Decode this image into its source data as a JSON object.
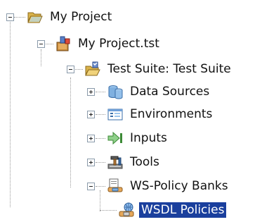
{
  "tree": {
    "root": {
      "label": "My Project",
      "icon": "open-folder-icon",
      "expanded": true
    },
    "test_file": {
      "label": "My Project.tst",
      "icon": "test-file-icon",
      "expanded": true
    },
    "test_suite": {
      "label": "Test Suite: Test Suite",
      "icon": "test-suite-folder-icon",
      "expanded": true
    },
    "children": [
      {
        "label": "Data Sources",
        "icon": "database-icon",
        "expanded": false
      },
      {
        "label": "Environments",
        "icon": "environment-icon",
        "expanded": false
      },
      {
        "label": "Inputs",
        "icon": "inputs-icon",
        "expanded": false
      },
      {
        "label": "Tools",
        "icon": "tools-icon",
        "expanded": false
      },
      {
        "label": "WS-Policy Banks",
        "icon": "policy-bank-icon",
        "expanded": true
      }
    ],
    "selected_child": {
      "label": "WSDL Policies",
      "icon": "wsdl-policy-icon",
      "selected": true
    }
  }
}
